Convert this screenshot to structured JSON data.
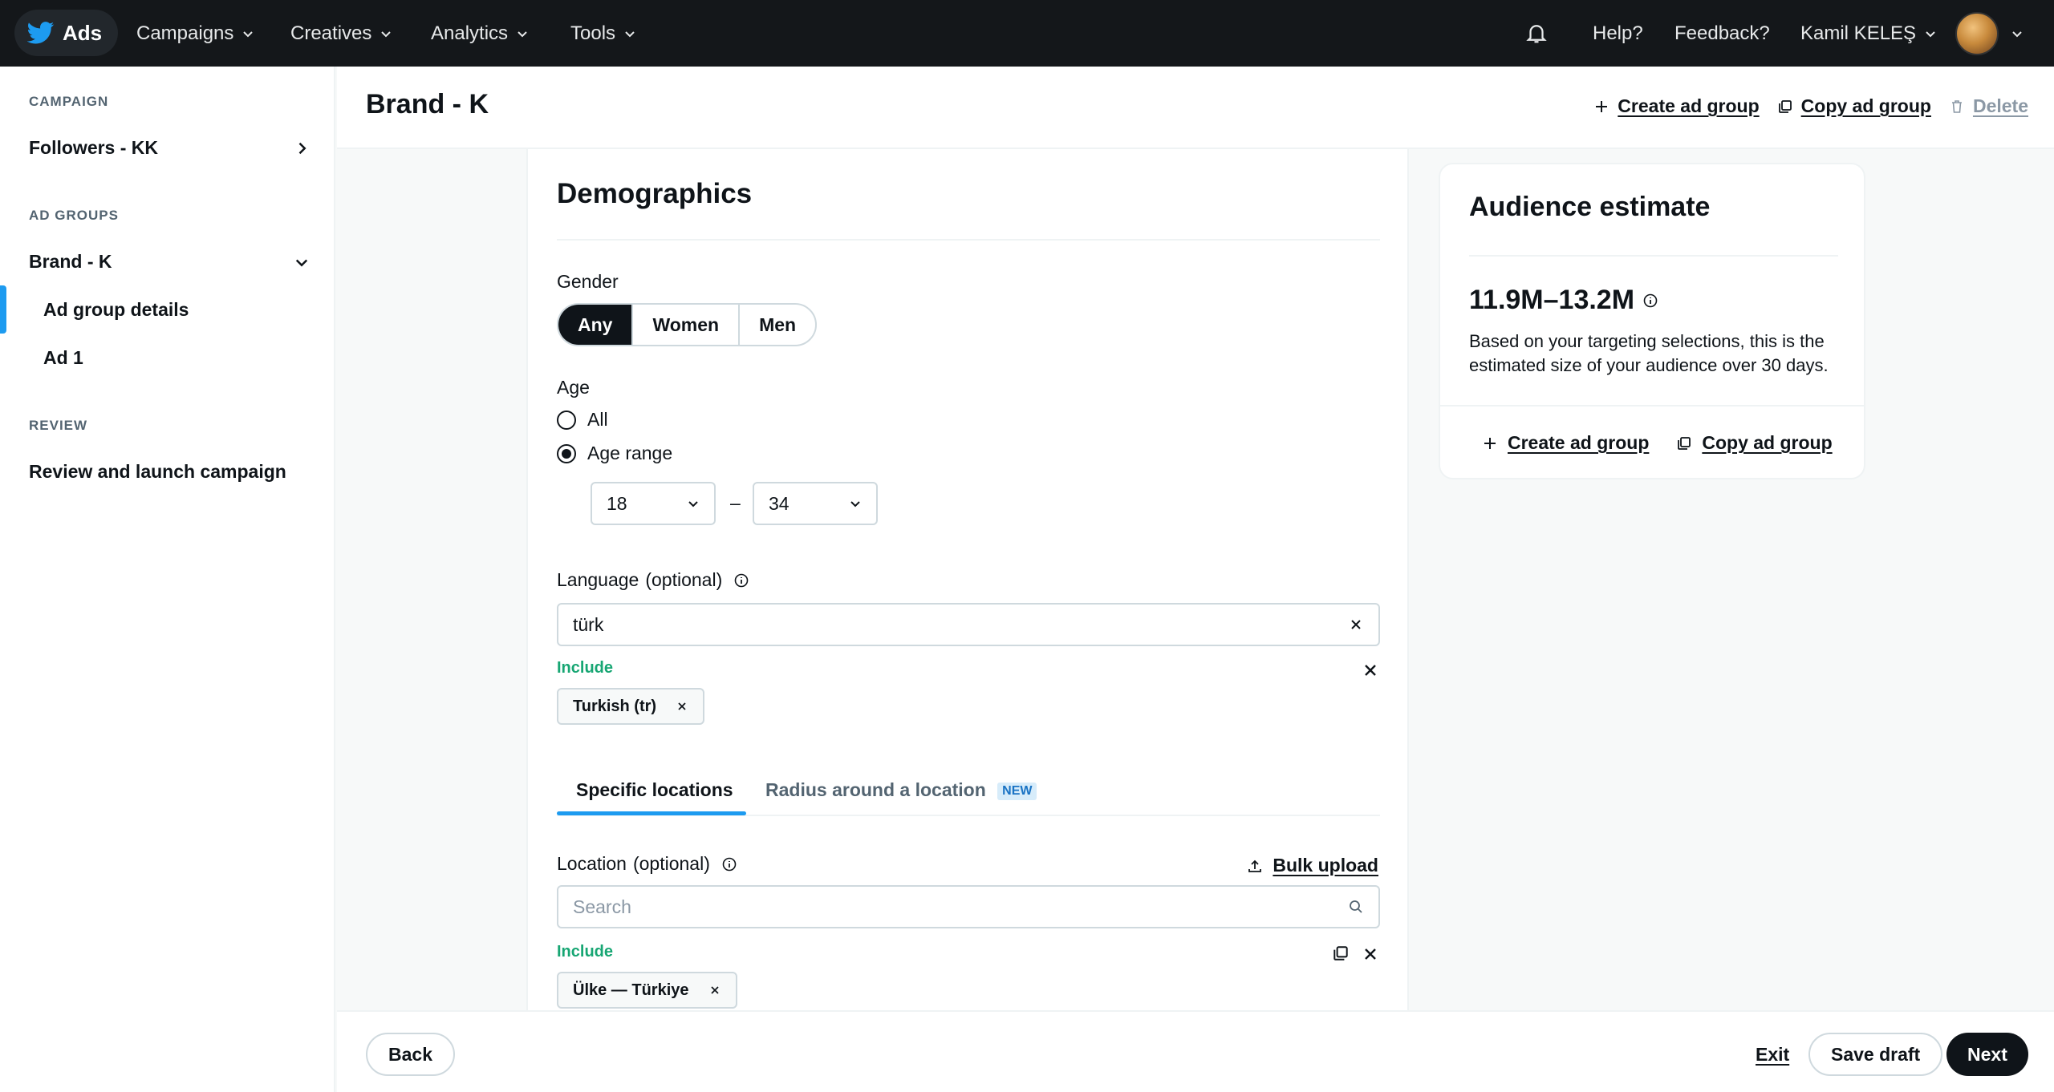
{
  "nav": {
    "brand": "Ads",
    "items": [
      "Campaigns",
      "Creatives",
      "Analytics",
      "Tools"
    ],
    "help": "Help?",
    "feedback": "Feedback?",
    "user": "Kamil KELEŞ"
  },
  "sidebar": {
    "campaign_section": "CAMPAIGN",
    "campaign_name": "Followers - KK",
    "adgroups_section": "AD GROUPS",
    "adgroup_name": "Brand - K",
    "adgroup_details": "Ad group details",
    "ad1": "Ad 1",
    "review_section": "REVIEW",
    "review_item": "Review and launch campaign"
  },
  "header": {
    "title": "Brand - K",
    "create": "Create ad group",
    "copy": "Copy ad group",
    "delete": "Delete"
  },
  "demographics": {
    "title": "Demographics",
    "gender_label": "Gender",
    "gender_options": [
      "Any",
      "Women",
      "Men"
    ],
    "age_label": "Age",
    "age_all": "All",
    "age_range": "Age range",
    "age_from": "18",
    "age_dash": "–",
    "age_to": "34",
    "language_label": "Language",
    "language_optional": "(optional)",
    "language_value": "türk",
    "include_label": "Include",
    "language_chip": "Turkish (tr)",
    "tab_specific": "Specific locations",
    "tab_radius": "Radius around a location",
    "tab_new": "NEW",
    "location_label": "Location",
    "location_optional": "(optional)",
    "bulk_upload": "Bulk upload",
    "location_placeholder": "Search",
    "location_include": "Include",
    "location_chip": "Ülke — Türkiye"
  },
  "audience": {
    "title": "Audience estimate",
    "estimate": "11.9M–13.2M",
    "description": "Based on your targeting selections, this is the estimated size of your audience over 30 days.",
    "create": "Create ad group",
    "copy": "Copy ad group"
  },
  "footer": {
    "back": "Back",
    "exit": "Exit",
    "save": "Save draft",
    "next": "Next"
  },
  "colors": {
    "accent": "#1d9bf0",
    "include": "#17a673",
    "nav_bg": "#14171a"
  }
}
